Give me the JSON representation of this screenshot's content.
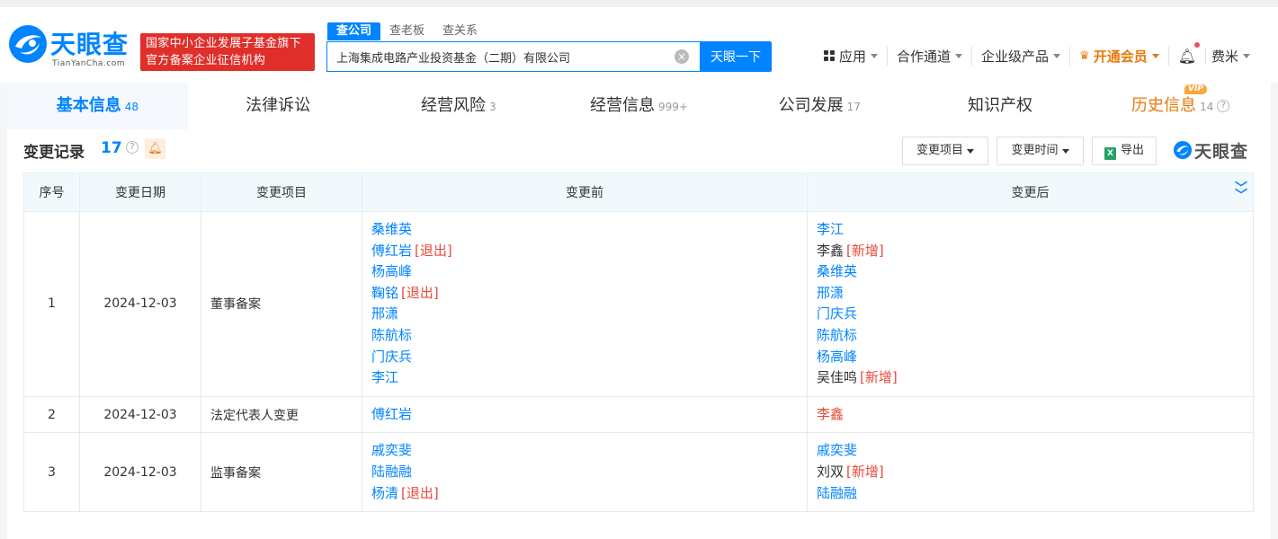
{
  "header": {
    "logo_name": "天眼查",
    "logo_url": "TianYanCha.com",
    "badge_line1": "国家中小企业发展子基金旗下",
    "badge_line2": "官方备案企业征信机构",
    "search_tabs": [
      "查公司",
      "查老板",
      "查关系"
    ],
    "search_value": "上海集成电路产业投资基金（二期）有限公司",
    "search_button": "天眼一下",
    "nav": {
      "apps": "应用",
      "partner": "合作通道",
      "enterprise": "企业级产品",
      "vip": "开通会员",
      "user": "费米"
    }
  },
  "tabs": [
    {
      "label": "基本信息",
      "count": "48"
    },
    {
      "label": "法律诉讼",
      "count": ""
    },
    {
      "label": "经营风险",
      "count": "3"
    },
    {
      "label": "经营信息",
      "count": "999+"
    },
    {
      "label": "公司发展",
      "count": "17"
    },
    {
      "label": "知识产权",
      "count": ""
    },
    {
      "label": "历史信息",
      "count": "14"
    }
  ],
  "vip_tag": "VIP",
  "section": {
    "title": "变更记录",
    "count": "17",
    "filter_item": "变更项目",
    "filter_time": "变更时间",
    "export": "导出",
    "brand": "天眼查"
  },
  "table": {
    "headers": [
      "序号",
      "变更日期",
      "变更项目",
      "变更前",
      "变更后"
    ],
    "rows": [
      {
        "index": "1",
        "date": "2024-12-03",
        "item": "董事备案",
        "before": [
          {
            "name": "桑维英",
            "tag": ""
          },
          {
            "name": "傅红岩",
            "tag": "[退出]"
          },
          {
            "name": "杨高峰",
            "tag": ""
          },
          {
            "name": "鞠铭",
            "tag": "[退出]"
          },
          {
            "name": "邢潇",
            "tag": ""
          },
          {
            "name": "陈航标",
            "tag": ""
          },
          {
            "name": "门庆兵",
            "tag": ""
          },
          {
            "name": "李江",
            "tag": ""
          }
        ],
        "after": [
          {
            "name": "李江",
            "tag": ""
          },
          {
            "name": "李鑫",
            "tag": "[新增]"
          },
          {
            "name": "桑维英",
            "tag": ""
          },
          {
            "name": "邢潇",
            "tag": ""
          },
          {
            "name": "门庆兵",
            "tag": ""
          },
          {
            "name": "陈航标",
            "tag": ""
          },
          {
            "name": "杨高峰",
            "tag": ""
          },
          {
            "name": "吴佳鸣",
            "tag": "[新增]"
          }
        ]
      },
      {
        "index": "2",
        "date": "2024-12-03",
        "item": "法定代表人变更",
        "before": [
          {
            "name": "傅红岩",
            "tag": ""
          }
        ],
        "after": [
          {
            "name": "李鑫",
            "tag": ""
          }
        ]
      },
      {
        "index": "3",
        "date": "2024-12-03",
        "item": "监事备案",
        "before": [
          {
            "name": "戚奕斐",
            "tag": ""
          },
          {
            "name": "陆融融",
            "tag": ""
          },
          {
            "name": "杨清",
            "tag": "[退出]"
          }
        ],
        "after": [
          {
            "name": "戚奕斐",
            "tag": ""
          },
          {
            "name": "刘双",
            "tag": "[新增]"
          },
          {
            "name": "陆融融",
            "tag": ""
          }
        ]
      }
    ]
  },
  "colors": {
    "accent": "#0084ff",
    "danger": "#e84a3a",
    "vip": "#e6790d",
    "badge_red": "#e02f2a"
  }
}
